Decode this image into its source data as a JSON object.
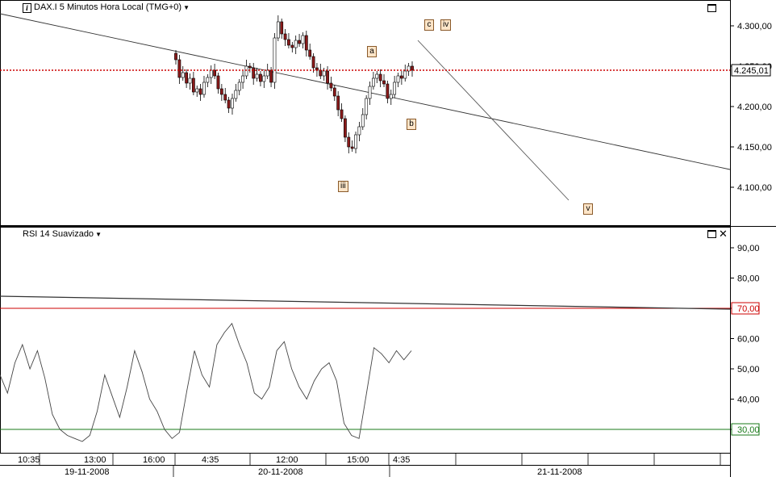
{
  "price_panel": {
    "title": "DAX.I 5 Minutos Hora Local (TMG+0)",
    "current_price_label": "4.245,01",
    "wave_labels": [
      "a",
      "b",
      "c",
      "iv",
      "iii",
      "v"
    ]
  },
  "rsi_panel": {
    "title": "RSI 14 Suavizado"
  },
  "time_axis": {
    "time_ticks": [
      "10:35",
      "13:00",
      "16:00",
      "4:35",
      "12:00",
      "15:00",
      "4:35"
    ],
    "date_ticks": [
      "19-11-2008",
      "20-11-2008",
      "21-11-2008"
    ]
  },
  "colors": {
    "candle_up": "#ffffff",
    "candle_down": "#8b1a1a",
    "current_price_line": "#cc0000",
    "overbought_line": "#cc0000",
    "oversold_line": "#1a7a1a",
    "trendline": "#333333",
    "rsi_line": "#444444"
  },
  "chart_data": [
    {
      "type": "line",
      "title": "DAX.I 5 Minutos Hora Local (TMG+0)",
      "ylim": [
        4055,
        4335
      ],
      "y_ticks": [
        "4.100,00",
        "4.150,00",
        "4.200,00",
        "4.250,00",
        "4.300,00"
      ],
      "current_price": 4245.01,
      "x_ticks": [
        "10:35",
        "13:00",
        "16:00",
        "4:35",
        "12:00",
        "15:00",
        "4:35"
      ],
      "series": [
        {
          "values": [
            4258,
            4236,
            4242,
            4229,
            4235,
            4218,
            4222,
            4215,
            4230,
            4236,
            4245,
            4238,
            4222,
            4215,
            4208,
            4198,
            4210,
            4220,
            4230,
            4238,
            4250,
            4248,
            4235,
            4240,
            4231,
            4238,
            4245,
            4230,
            4285,
            4305,
            4290,
            4283,
            4276,
            4273,
            4282,
            4278,
            4288,
            4270,
            4262,
            4248,
            4245,
            4238,
            4244,
            4229,
            4223,
            4213,
            4196,
            4185,
            4162,
            4150,
            4148,
            4165,
            4175,
            4190,
            4210,
            4225,
            4235,
            4240,
            4232,
            4228,
            4210,
            4215,
            4230,
            4238,
            4235,
            4244,
            4250,
            4245
          ]
        }
      ],
      "annotations": [
        "a",
        "b",
        "c",
        "iv",
        "iii",
        "v"
      ]
    },
    {
      "type": "line",
      "title": "RSI 14 Suavizado",
      "ylim": [
        24,
        96
      ],
      "y_ticks": [
        "30,00",
        "40,00",
        "50,00",
        "60,00",
        "70,00",
        "80,00",
        "90,00"
      ],
      "levels": [
        30,
        70
      ],
      "series": [
        {
          "values": [
            48,
            42,
            52,
            58,
            50,
            56,
            47,
            35,
            30,
            28,
            27,
            26,
            28,
            36,
            48,
            41,
            34,
            44,
            56,
            49,
            40,
            36,
            30,
            27,
            29,
            43,
            56,
            48,
            44,
            58,
            62,
            65,
            58,
            52,
            42,
            40,
            44,
            56,
            59,
            50,
            44,
            40,
            46,
            50,
            52,
            46,
            32,
            28,
            27,
            42,
            57,
            55,
            52,
            56,
            53,
            56
          ]
        }
      ]
    }
  ]
}
